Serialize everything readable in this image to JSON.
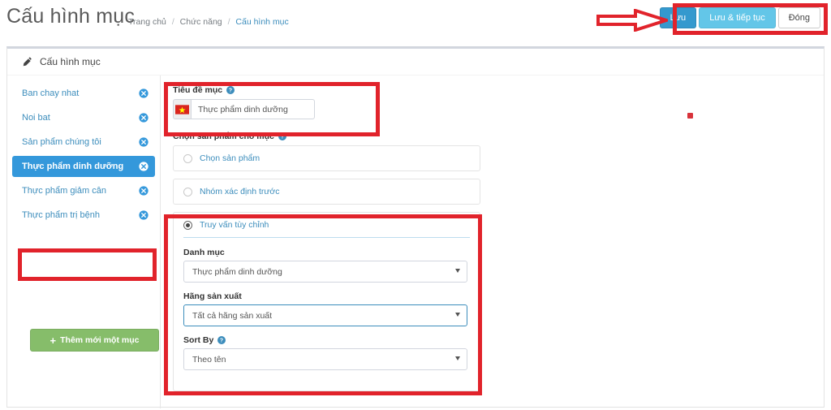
{
  "header": {
    "title": "Cấu hình mục",
    "breadcrumb": [
      {
        "label": "Trang chủ",
        "active": false
      },
      {
        "label": "Chức năng",
        "active": false
      },
      {
        "label": "Cấu hình mục",
        "active": true
      }
    ],
    "separator": "/",
    "buttons": {
      "save": "Lưu",
      "save_continue": "Lưu & tiếp tục",
      "close": "Đóng"
    }
  },
  "panel": {
    "icon": "pencil-icon",
    "title": "Cấu hình mục"
  },
  "sidebar": {
    "items": [
      {
        "label": "Ban chay nhat",
        "active": false
      },
      {
        "label": "Noi bat",
        "active": false
      },
      {
        "label": "Sản phẩm chúng tôi",
        "active": false
      },
      {
        "label": "Thực phẩm dinh dưỡng",
        "active": true
      },
      {
        "label": "Thực phẩm giảm cân",
        "active": false
      },
      {
        "label": "Thực phẩm trị bệnh",
        "active": false
      }
    ],
    "remove_icon": "close-circle-icon",
    "add_button": {
      "label": "Thêm mới một mục",
      "icon": "plus-icon"
    }
  },
  "form": {
    "title_field": {
      "label": "Tiêu đề mục",
      "help_icon": "help-circle-icon",
      "flag_icon": "vietnam-flag-icon",
      "value": "Thực phẩm dinh dưỡng",
      "placeholder": "Tiêu đề mục"
    },
    "product_select": {
      "label": "Chọn sản phẩm cho mục",
      "help_icon": "help-circle-icon",
      "options": [
        {
          "label": "Chọn sản phẩm",
          "checked": false
        },
        {
          "label": "Nhóm xác định trước",
          "checked": false
        },
        {
          "label": "Truy vấn tùy chỉnh",
          "checked": true
        }
      ]
    },
    "custom_query": {
      "category": {
        "label": "Danh mục",
        "value": "Thực phẩm dinh dưỡng",
        "focused": false
      },
      "manufacturer": {
        "label": "Hãng sản xuất",
        "value": "Tất cả hãng sản xuất",
        "focused": true
      },
      "sort_by": {
        "label": "Sort By",
        "help_icon": "help-circle-icon",
        "value": "Theo tên",
        "focused": false
      }
    }
  },
  "annotations": {
    "arrow_color": "#e1232b",
    "box_color": "#e1232b",
    "dot_color": "#d8333b"
  }
}
